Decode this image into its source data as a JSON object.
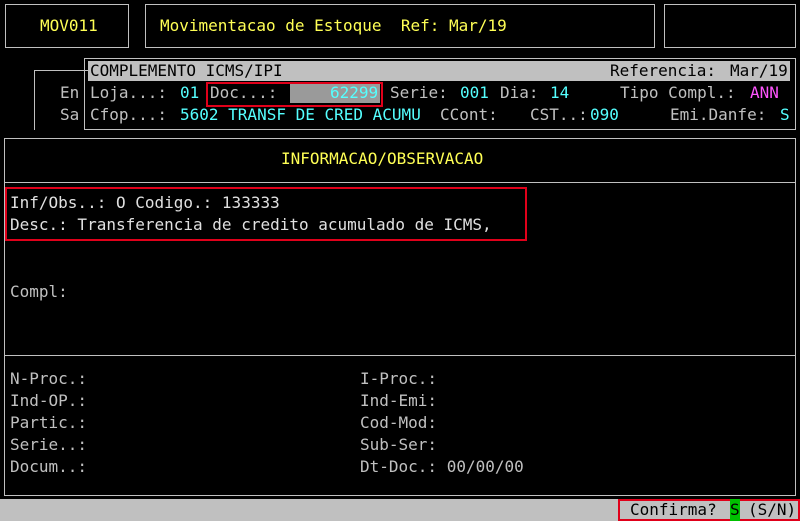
{
  "header": {
    "program_code": "MOV011",
    "title": "Movimentacao de Estoque  Ref: Mar/19"
  },
  "subheader": {
    "section_title": "COMPLEMENTO ICMS/IPI",
    "referencia_label": "Referencia:",
    "referencia_value": "Mar/19"
  },
  "behind": {
    "line1": "En",
    "line2": "Sa"
  },
  "fields_row1": {
    "loja_label": "Loja...:",
    "loja_value": "01",
    "doc_label": "Doc...:",
    "doc_value": "62299",
    "serie_label": "Serie:",
    "serie_value": "001",
    "dia_label": "Dia:",
    "dia_value": "14",
    "tipo_label": "Tipo Compl.:",
    "tipo_value": "ANN"
  },
  "fields_row2": {
    "cfop_label": "Cfop...:",
    "cfop_value": "5602 TRANSF DE CRED ACUMU",
    "ccont_label": "CCont:",
    "cst_label": "CST..:",
    "cst_value": "090",
    "emi_label": "Emi.Danfe:",
    "emi_value": "S"
  },
  "info": {
    "section_title": "INFORMACAO/OBSERVACAO",
    "inf_obs_line": "Inf/Obs..: O Codigo.: 133333",
    "desc_line": "Desc.: Transferencia de credito acumulado de ICMS,",
    "compl_label": "Compl:"
  },
  "bottom_fields": {
    "left": [
      "N-Proc.:",
      "Ind-OP.:",
      "Partic.:",
      "Serie..:",
      "Docum..:"
    ],
    "right": [
      "I-Proc.:",
      "Ind-Emi:",
      "Cod-Mod:",
      "Sub-Ser:",
      "Dt-Doc.: 00/00/00"
    ]
  },
  "status": {
    "confirm_label": "Confirma?",
    "confirm_value": "S",
    "confirm_options": "(S/N)"
  }
}
